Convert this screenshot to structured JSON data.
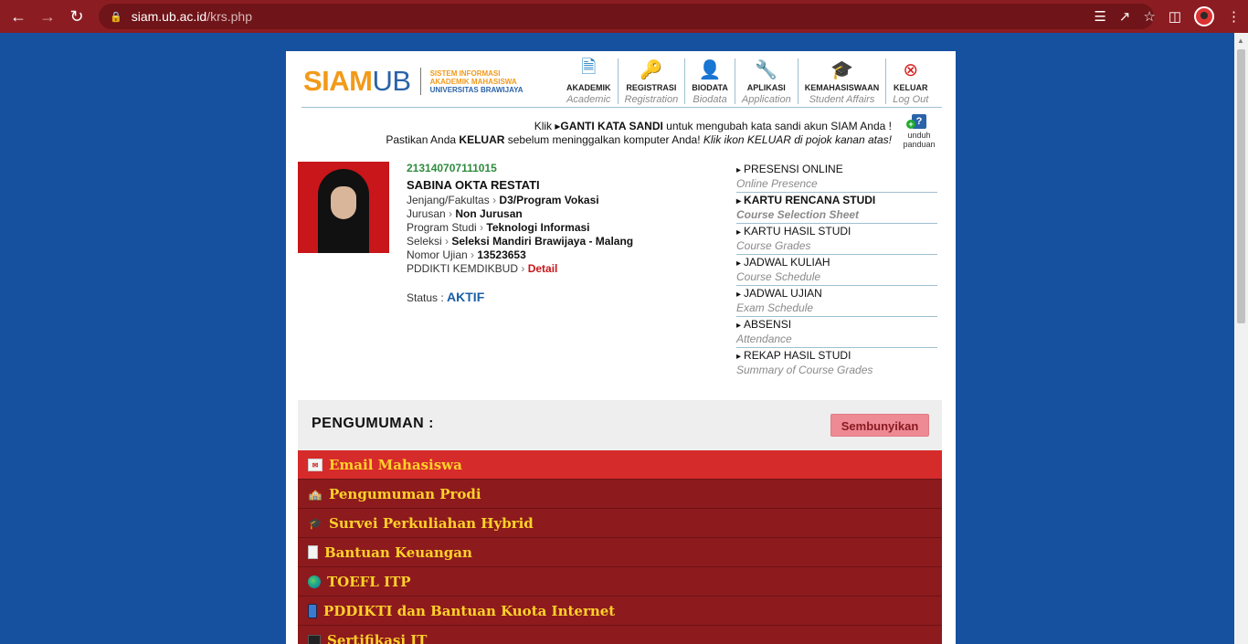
{
  "browser": {
    "url_host": "siam.ub.ac.id",
    "url_path": "/krs.php"
  },
  "logo": {
    "siam": "SIAM",
    "ub": "UB",
    "line1": "SISTEM INFORMASI",
    "line2": "AKADEMIK MAHASISWA",
    "line3": "UNIVERSITAS BRAWIJAYA"
  },
  "menu": [
    {
      "label": "AKADEMIK",
      "sub": "Academic",
      "icon": "document-icon"
    },
    {
      "label": "REGISTRASI",
      "sub": "Registration",
      "icon": "key-icon"
    },
    {
      "label": "BIODATA",
      "sub": "Biodata",
      "icon": "user-icon"
    },
    {
      "label": "APLIKASI",
      "sub": "Application",
      "icon": "wrench-icon"
    },
    {
      "label": "KEMAHASISWAAN",
      "sub": "Student Affairs",
      "icon": "graduation-cap-icon"
    },
    {
      "label": "KELUAR",
      "sub": "Log Out",
      "icon": "close-circle-icon"
    }
  ],
  "notice": {
    "line1_pre": "Klik ",
    "line1_link": "GANTI KATA SANDI",
    "line1_post": " untuk mengubah kata sandi akun SIAM Anda !",
    "line2_pre": "Pastikan Anda ",
    "line2_bold": "KELUAR",
    "line2_mid": " sebelum meninggalkan komputer Anda! ",
    "line2_italic": "Klik ikon KELUAR di pojok kanan atas!"
  },
  "guide": {
    "label1": "unduh",
    "label2": "panduan"
  },
  "profile": {
    "nim": "213140707111015",
    "name": "SABINA OKTA RESTATI",
    "jenjang_label": "Jenjang/Fakultas",
    "jenjang_value": "D3/Program Vokasi",
    "jurusan_label": "Jurusan",
    "jurusan_value": "Non Jurusan",
    "prodi_label": "Program Studi",
    "prodi_value": "Teknologi Informasi",
    "seleksi_label": "Seleksi",
    "seleksi_value": "Seleksi Mandiri Brawijaya - Malang",
    "ujian_label": "Nomor Ujian",
    "ujian_value": "13523653",
    "pddikti_label": "PDDIKTI KEMDIKBUD",
    "pddikti_link": "Detail",
    "status_label": "Status :",
    "status_value": "AKTIF"
  },
  "side_menu": [
    {
      "title": "PRESENSI ONLINE",
      "sub": "Online Presence"
    },
    {
      "title": "KARTU RENCANA STUDI",
      "sub": "Course Selection Sheet"
    },
    {
      "title": "KARTU HASIL STUDI",
      "sub": "Course Grades"
    },
    {
      "title": "JADWAL KULIAH",
      "sub": "Course Schedule"
    },
    {
      "title": "JADWAL UJIAN",
      "sub": "Exam Schedule"
    },
    {
      "title": "ABSENSI",
      "sub": "Attendance"
    },
    {
      "title": "REKAP HASIL STUDI",
      "sub": "Summary of Course Grades"
    }
  ],
  "announcements": {
    "title": "PENGUMUMAN :",
    "hide_label": "Sembunyikan",
    "items": [
      {
        "label": "Email Mahasiswa",
        "icon": "mail-icon"
      },
      {
        "label": "Pengumuman Prodi",
        "icon": "school-icon"
      },
      {
        "label": "Survei Perkuliahan Hybrid",
        "icon": "graduation-cap-icon"
      },
      {
        "label": "Bantuan Keuangan",
        "icon": "document-icon"
      },
      {
        "label": "TOEFL ITP",
        "icon": "globe-icon"
      },
      {
        "label": "PDDIKTI dan Bantuan Kuota Internet",
        "icon": "phone-icon"
      },
      {
        "label": "Sertifikasi IT",
        "icon": "monitor-icon"
      }
    ]
  },
  "colors": {
    "browser_bar": "#8b1d22",
    "page_bg": "#1651a0",
    "brand_orange": "#f29a1a",
    "brand_blue": "#2a63a8",
    "announcement_row": "#8d1a1d",
    "announcement_active": "#d62b2b",
    "announcement_text": "#ffd12a"
  }
}
